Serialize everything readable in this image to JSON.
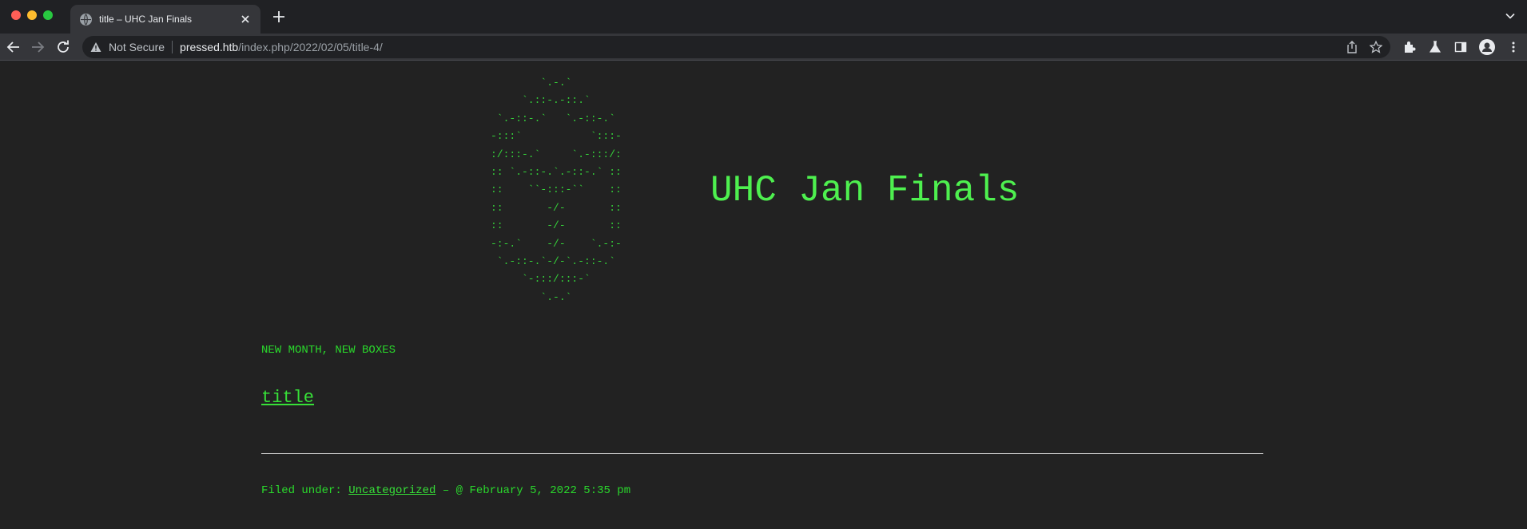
{
  "browser": {
    "tab": {
      "title": "title – UHC Jan Finals",
      "favicon": "globe-icon",
      "close_icon": "close-icon"
    },
    "new_tab_icon": "plus-icon",
    "address_bar": {
      "security_icon": "warning-triangle-icon",
      "security_label": "Not Secure",
      "url_host": "pressed.htb",
      "url_path": "/index.php/2022/02/05/title-4/"
    },
    "toolbar_icons": [
      "share-icon",
      "star-icon",
      "extensions-icon",
      "labs-icon",
      "side-panel-icon",
      "profile-icon",
      "more-icon"
    ],
    "traffic_lights": {
      "close": "#ff5f57",
      "minimize": "#febc2e",
      "maximize": "#28c840"
    }
  },
  "site": {
    "ascii_logo": "        `.-.`\n     `.::-.-::.`\n `.-::-.`   `.-::-.`\n-:::`           `:::-\n:/:::-.`     `.-:::/:\n:: `.-::-.`.-::-.` ::\n::    ``-:::-``    ::\n::       -/-       ::\n::       -/-       ::\n-:-.`    -/-    `.-:-\n `.-::-.`-/-`.-::-.`\n     `-:::/:::-`\n        `.-.`",
    "title": "UHC Jan Finals",
    "tagline": "NEW MONTH, NEW BOXES"
  },
  "post": {
    "title": "title",
    "filed_under_label": "Filed under:",
    "category": "Uncategorized",
    "date_text": "– @ February 5, 2022 5:35 pm"
  },
  "colors": {
    "page_bg": "#222222",
    "accent_green": "#29d12a",
    "title_green": "#4ef04f"
  }
}
